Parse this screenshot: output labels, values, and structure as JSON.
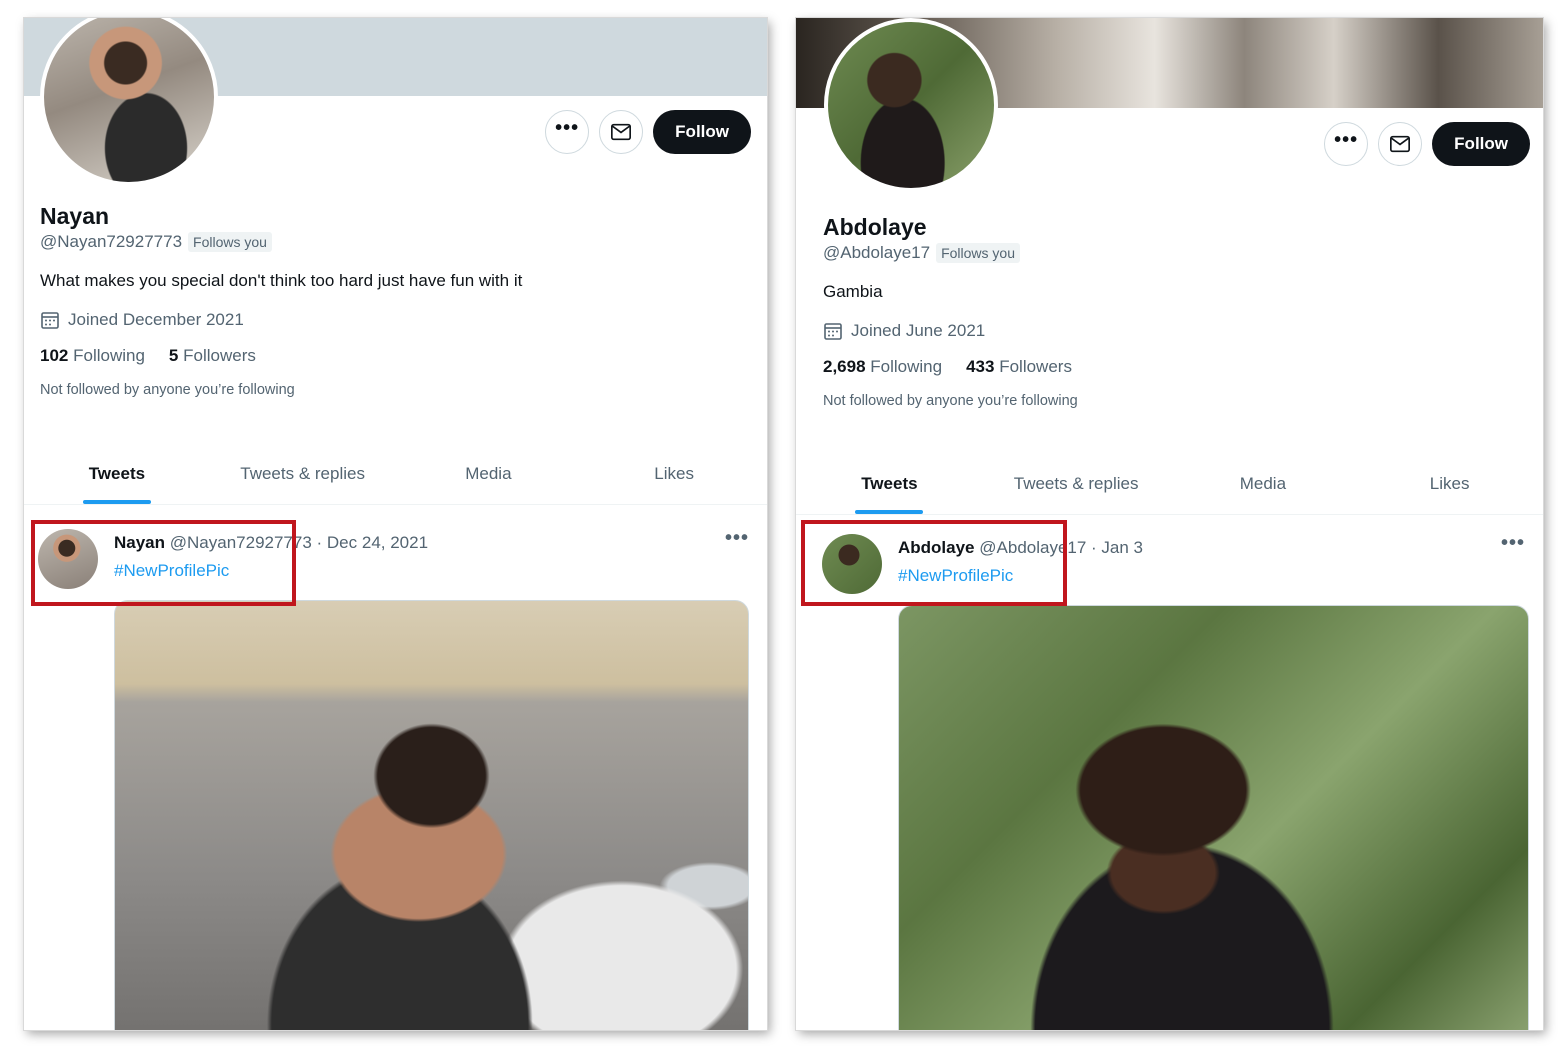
{
  "profiles": [
    {
      "name": "Nayan",
      "handle": "@Nayan72927773",
      "follows_you": "Follows you",
      "bio": "What makes you special don't think too hard just have fun with it",
      "joined": "Joined December 2021",
      "following_count": "102",
      "following_label": "Following",
      "followers_count": "5",
      "followers_label": "Followers",
      "note": "Not followed by anyone you’re following",
      "follow_label": "Follow",
      "more_label": "•••",
      "tabs": [
        "Tweets",
        "Tweets & replies",
        "Media",
        "Likes"
      ],
      "tweet": {
        "name": "Nayan",
        "handle_date": "@Nayan72927773 · Dec 24, 2021",
        "hashtag": "#NewProfilePic",
        "more": "•••"
      }
    },
    {
      "name": "Abdolaye",
      "handle": "@Abdolaye17",
      "follows_you": "Follows you",
      "bio": "Gambia",
      "joined": "Joined June 2021",
      "following_count": "2,698",
      "following_label": "Following",
      "followers_count": "433",
      "followers_label": "Followers",
      "note": "Not followed by anyone you’re following",
      "follow_label": "Follow",
      "more_label": "•••",
      "tabs": [
        "Tweets",
        "Tweets & replies",
        "Media",
        "Likes"
      ],
      "tweet": {
        "name": "Abdolaye",
        "handle_date": "@Abdolaye17 · Jan 3",
        "hashtag": "#NewProfilePic",
        "more": "•••"
      }
    }
  ],
  "colors": {
    "accent": "#1d9bf0",
    "highlight": "#c0161d",
    "text": "#0f1419",
    "muted": "#536471"
  }
}
